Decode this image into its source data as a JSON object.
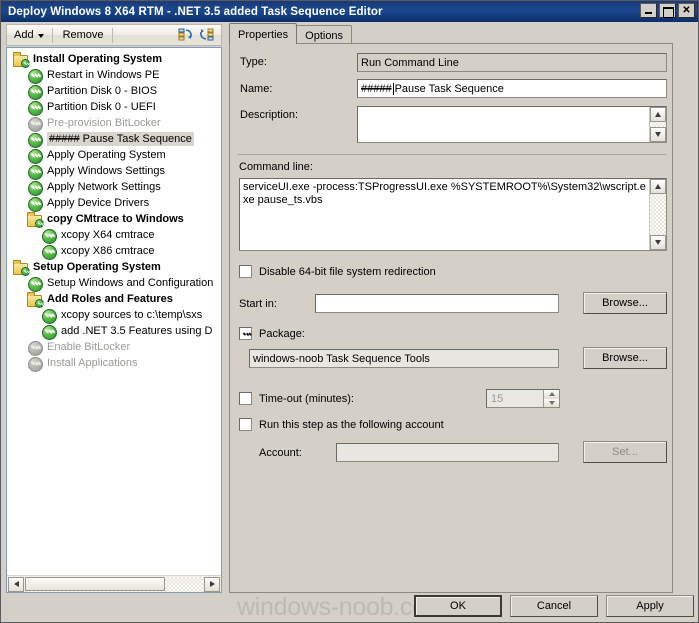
{
  "window": {
    "title": "Deploy Windows 8 X64 RTM - .NET 3.5 added Task Sequence Editor",
    "minimize_label": "_",
    "maximize_label": "",
    "close_label": "✕"
  },
  "toolbar": {
    "add_label": "Add",
    "remove_label": "Remove",
    "icon_move_up": "move-up-icon",
    "icon_move_down": "move-down-icon"
  },
  "tree": {
    "nodes": [
      {
        "label": "Install Operating System",
        "type": "group",
        "indent": 0,
        "state": "enabled"
      },
      {
        "label": "Restart in Windows PE",
        "type": "step",
        "indent": 1,
        "state": "enabled"
      },
      {
        "label": "Partition Disk 0 - BIOS",
        "type": "step",
        "indent": 1,
        "state": "enabled"
      },
      {
        "label": "Partition Disk 0 - UEFI",
        "type": "step",
        "indent": 1,
        "state": "enabled"
      },
      {
        "label": "Pre-provision BitLocker",
        "type": "step",
        "indent": 1,
        "state": "disabled"
      },
      {
        "label": "##### Pause Task Sequence",
        "prefix": "#####",
        "suffix": " Pause Task Sequence",
        "type": "step",
        "indent": 1,
        "state": "selected"
      },
      {
        "label": "Apply Operating System",
        "type": "step",
        "indent": 1,
        "state": "enabled"
      },
      {
        "label": "Apply Windows Settings",
        "type": "step",
        "indent": 1,
        "state": "enabled"
      },
      {
        "label": "Apply Network Settings",
        "type": "step",
        "indent": 1,
        "state": "enabled"
      },
      {
        "label": "Apply Device Drivers",
        "type": "step",
        "indent": 1,
        "state": "enabled"
      },
      {
        "label": "copy CMtrace to Windows",
        "type": "group",
        "indent": 1,
        "state": "enabled"
      },
      {
        "label": "xcopy X64 cmtrace",
        "type": "step",
        "indent": 2,
        "state": "enabled"
      },
      {
        "label": "xcopy X86 cmtrace",
        "type": "step",
        "indent": 2,
        "state": "enabled"
      },
      {
        "label": "Setup Operating System",
        "type": "group",
        "indent": 0,
        "state": "enabled"
      },
      {
        "label": "Setup Windows and Configuration",
        "type": "step",
        "indent": 1,
        "state": "enabled"
      },
      {
        "label": "Add Roles and Features",
        "type": "group",
        "indent": 1,
        "state": "enabled"
      },
      {
        "label": "xcopy sources to c:\\temp\\sxs",
        "type": "step",
        "indent": 2,
        "state": "enabled"
      },
      {
        "label": "add .NET 3.5 Features using D",
        "type": "step",
        "indent": 2,
        "state": "enabled"
      },
      {
        "label": "Enable BitLocker",
        "type": "step",
        "indent": 1,
        "state": "disabled"
      },
      {
        "label": "Install Applications",
        "type": "step",
        "indent": 1,
        "state": "disabled"
      }
    ]
  },
  "tabs": [
    {
      "label": "Properties",
      "active": true
    },
    {
      "label": "Options",
      "active": false
    }
  ],
  "properties": {
    "type_label": "Type:",
    "type_value": "Run Command Line",
    "name_label": "Name:",
    "name_prefix": "#####",
    "name_suffix": " Pause Task Sequence",
    "description_label": "Description:",
    "description_value": "",
    "command_line_label": "Command line:",
    "command_line_value": "serviceUI.exe -process:TSProgressUI.exe %SYSTEMROOT%\\System32\\wscript.exe pause_ts.vbs",
    "disable_redirection_label": "Disable 64-bit file system redirection",
    "disable_redirection_checked": false,
    "start_in_label": "Start in:",
    "start_in_value": "",
    "start_in_browse_label": "Browse...",
    "package_label": "Package:",
    "package_checked": true,
    "package_value": "windows-noob Task Sequence Tools",
    "package_browse_label": "Browse...",
    "timeout_label": "Time-out (minutes):",
    "timeout_checked": false,
    "timeout_value": "15",
    "run_as_label": "Run this step as the following account",
    "run_as_checked": false,
    "account_label": "Account:",
    "account_value": "",
    "set_label": "Set..."
  },
  "footer": {
    "ok_label": "OK",
    "cancel_label": "Cancel",
    "apply_label": "Apply",
    "watermark": "windows-noob.com"
  }
}
